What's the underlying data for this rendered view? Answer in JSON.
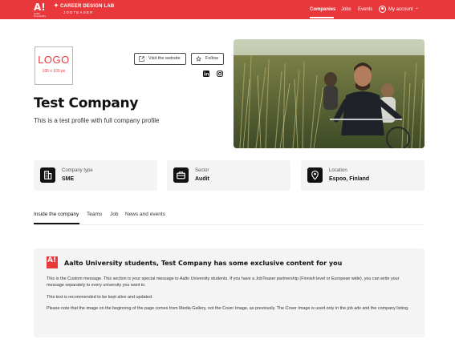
{
  "brand": {
    "mark": "A!",
    "mark_sub": "Aalto University",
    "line1": "CAREER DESIGN LAB",
    "line2": "JOBTEASER"
  },
  "nav": {
    "companies": "Companies",
    "jobs": "Jobs",
    "events": "Events",
    "account": "My account",
    "account_caret": "⌄"
  },
  "header": {
    "logo_text": "LOGO",
    "logo_size": "100 x 100 px",
    "visit_button": "Visit the website",
    "follow_button": "Follow",
    "company_name": "Test Company",
    "tagline": "This is a test profile with full company profile",
    "social_icons": [
      "linkedin-icon",
      "instagram-icon"
    ]
  },
  "info_cards": [
    {
      "icon": "building-icon",
      "label": "Company type",
      "value": "SME"
    },
    {
      "icon": "briefcase-icon",
      "label": "Sector",
      "value": "Audit"
    },
    {
      "icon": "location-pin-icon",
      "label": "Location",
      "value": "Espoo, Finland"
    }
  ],
  "tabs": [
    "Inside the company",
    "Teams",
    "Job",
    "News and events"
  ],
  "message": {
    "logo": "A!",
    "title": "Aalto University students, Test Company has some exclusive content for you",
    "paragraphs": [
      "This is the Custom message. This section is your special message to Aalto University students. If you have a JobTeaser partnership (Finnish level or European wide), you can write your message separately to every university you want to.",
      "This text is recommended to be kept alive and updated.",
      "Please note that the image on the beginning of the page comes from Media Gallery, not the Cover Image, as previously. The Cover Image is used only in the job ads and the company listing."
    ]
  },
  "colors": {
    "brand": "#e8383b",
    "card_bg": "#f4f4f5",
    "text": "#111111"
  }
}
